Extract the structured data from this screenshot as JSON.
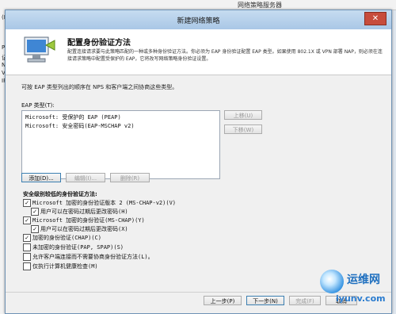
{
  "background": {
    "window_title": "网络策略服务器",
    "left_items": [
      "(F)",
      "PS (",
      "记",
      "N",
      "V",
      "IP"
    ]
  },
  "dialog": {
    "title": "新建网络策略",
    "close_glyph": "✕",
    "header": {
      "title": "配置身份验证方法",
      "description": "配置连接请求要与此策略匹配的一种或多种身份验证方法。你必须为 EAP 身份验证配置 EAP 类型。如果使用 802.1X 或 VPN 部署 NAP，则必须在连接请求策略中配置受保护的 EAP，它将改写网络策略身份验证设置。"
    },
    "intro": "可按 EAP 类型列出的顺序在 NPS 和客户端之间协商这些类型。",
    "eap_label": "EAP 类型(T):",
    "eap_types": [
      "Microsoft: 受保护的 EAP (PEAP)",
      "Microsoft: 安全密码(EAP-MSCHAP v2)"
    ],
    "buttons": {
      "move_up": "上移(U)",
      "move_down": "下移(W)",
      "add": "添加(D)...",
      "edit": "编辑(I)...",
      "remove": "删除(R)",
      "previous": "上一步(P)",
      "next": "下一步(N)",
      "finish": "完成(F)",
      "cancel": "取消"
    },
    "security_label": "安全级别较低的身份验证方法:",
    "checkboxes": [
      {
        "label": "Microsoft 加密的身份验证版本 2 (MS-CHAP-v2)(V)",
        "checked": true
      },
      {
        "label": "用户可以在密码过期后更改密码(H)",
        "checked": true
      },
      {
        "label": "Microsoft 加密的身份验证(MS-CHAP)(Y)",
        "checked": true
      },
      {
        "label": "用户可以在密码过期后更改密码(X)",
        "checked": true
      },
      {
        "label": "加密的身份验证(CHAP)(C)",
        "checked": true
      },
      {
        "label": "未加密的身份验证(PAP, SPAP)(S)",
        "checked": false
      },
      {
        "label": "允许客户端连接而不需要协商身份验证方法(L)。",
        "checked": false
      },
      {
        "label": "仅执行计算机健康检查(M)",
        "checked": false
      }
    ]
  },
  "watermark": {
    "line1": "运维网",
    "line2": "iyunv.com"
  }
}
